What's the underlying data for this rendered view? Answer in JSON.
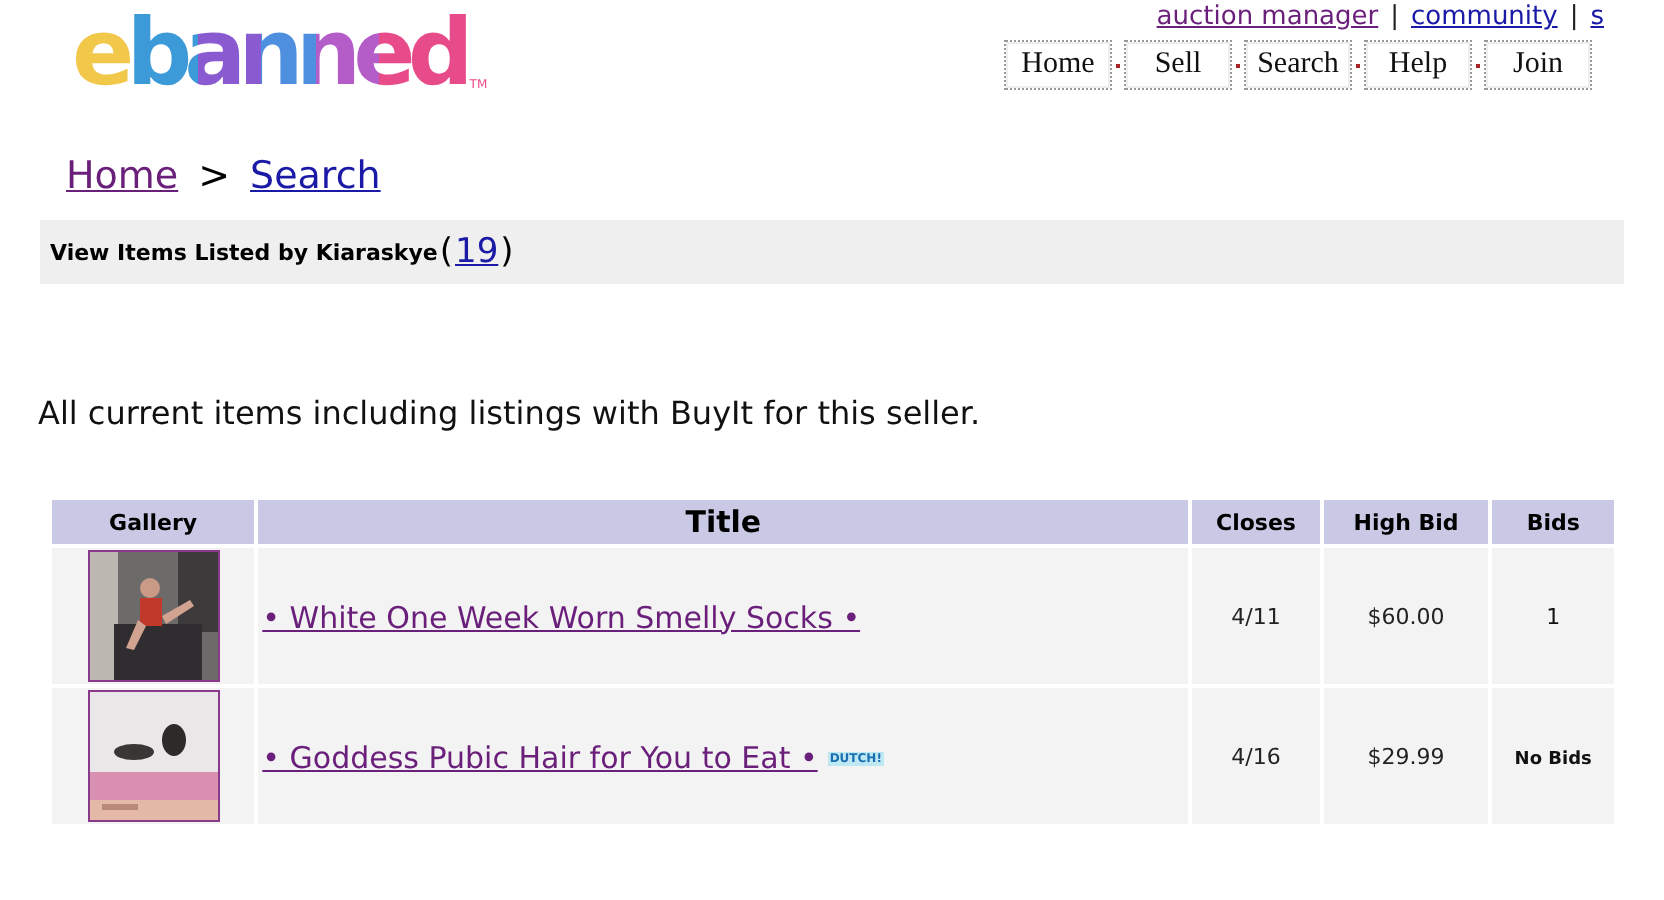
{
  "logo": {
    "text": "ebanned",
    "mark": "TM"
  },
  "top_link_separator": "|",
  "top_links": [
    {
      "label": "auction manager",
      "visited": true
    },
    {
      "label": "community",
      "visited": false
    },
    {
      "label": "s",
      "visited": false
    }
  ],
  "nav_buttons": [
    "Home",
    "Sell",
    "Search",
    "Help",
    "Join"
  ],
  "breadcrumb": [
    {
      "label": "Home",
      "visited": true
    },
    {
      "label": "Search",
      "visited": false
    }
  ],
  "breadcrumb_separator": ">",
  "listing_bar": {
    "label": "View Items Listed by Kiaraskye",
    "count": "19",
    "open_paren": "(",
    "close_paren": ")"
  },
  "intro": "All current items including listings with BuyIt for this seller.",
  "table": {
    "columns": [
      "Gallery",
      "Title",
      "Closes",
      "High Bid",
      "Bids"
    ],
    "rows": [
      {
        "title": "• White One Week Worn Smelly Socks •",
        "dutch": false,
        "closes": "4/11",
        "high_bid": "$60.00",
        "bids": "1",
        "no_bids": false
      },
      {
        "title": "• Goddess Pubic Hair for You to Eat •",
        "dutch": true,
        "dutch_label": "DUTCH!",
        "closes": "4/16",
        "high_bid": "$29.99",
        "bids": "No Bids",
        "no_bids": true
      }
    ]
  }
}
